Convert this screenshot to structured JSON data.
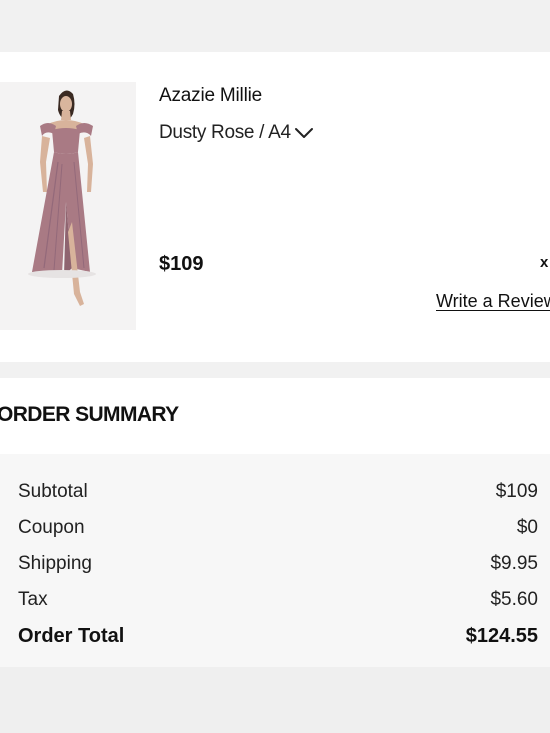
{
  "product": {
    "name": "Azazie Millie",
    "variant": "Dusty Rose / A4",
    "price": "$109",
    "remove_label": "x",
    "review_link": "Write a Review",
    "color": "#a97a84"
  },
  "summary": {
    "title": "ORDER SUMMARY",
    "rows": [
      {
        "label": "Subtotal",
        "value": "$109"
      },
      {
        "label": "Coupon",
        "value": "$0"
      },
      {
        "label": "Shipping",
        "value": "$9.95"
      },
      {
        "label": "Tax",
        "value": "$5.60"
      }
    ],
    "total": {
      "label": "Order Total",
      "value": "$124.55"
    }
  }
}
